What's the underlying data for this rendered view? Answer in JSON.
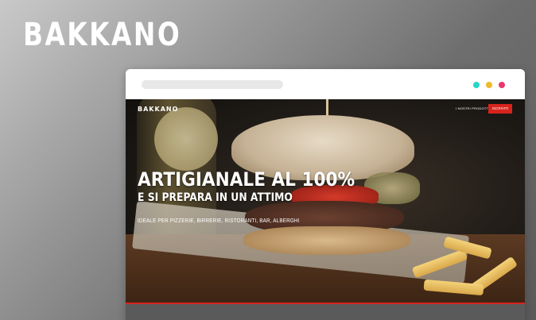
{
  "brand": {
    "logo_text": "BAKKANO"
  },
  "browser": {
    "dots": [
      {
        "name": "teal",
        "color": "#2ad4c8"
      },
      {
        "name": "yellow",
        "color": "#f0b92a"
      },
      {
        "name": "pink",
        "color": "#e8396a"
      }
    ]
  },
  "site": {
    "logo_text": "BAKKANO",
    "nav": {
      "link_label": "I NOSTRI PRODOTTI",
      "button_label": "ISCRIVITI",
      "button_color": "#d8231c"
    },
    "hero": {
      "title": "ARTIGIANALE AL 100%",
      "subtitle": "E SI PREPARA IN UN ATTIMO",
      "tagline": "IDEALE PER PIZZERIE, BIRRERIE, RISTORANTI, BAR, ALBERGHI"
    }
  }
}
